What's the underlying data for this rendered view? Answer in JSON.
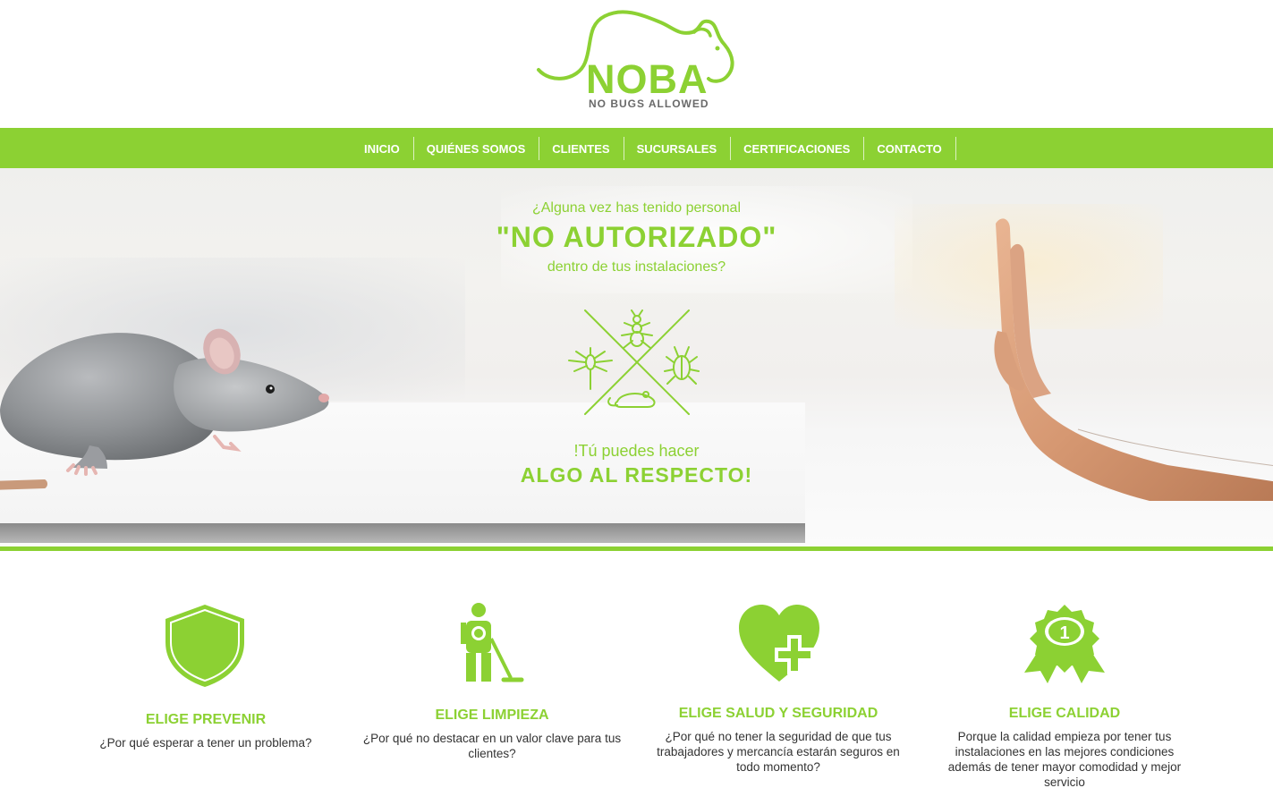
{
  "brand": {
    "name": "NOBA",
    "tagline": "NO BUGS ALLOWED",
    "color": "#8cd133"
  },
  "nav": {
    "items": [
      {
        "label": "INICIO"
      },
      {
        "label": "QUIÉNES SOMOS"
      },
      {
        "label": "CLIENTES"
      },
      {
        "label": "SUCURSALES"
      },
      {
        "label": "CERTIFICACIONES"
      },
      {
        "label": "CONTACTO"
      }
    ]
  },
  "hero": {
    "question_line1": "¿Alguna vez has tenido personal",
    "headline": "\"NO AUTORIZADO\"",
    "question_line2": "dentro de tus instalaciones?",
    "cta_line1": "!Tú puedes hacer",
    "cta_line2": "ALGO AL RESPECTO!",
    "images": [
      "rat-photo",
      "stop-hand-photo",
      "no-pests-emblem"
    ]
  },
  "features": [
    {
      "icon": "shield-icon",
      "title": "ELIGE PREVENIR",
      "text": "¿Por qué esperar a tener un problema?"
    },
    {
      "icon": "cleaner-icon",
      "title": "ELIGE LIMPIEZA",
      "text": "¿Por qué no destacar en un valor clave para tus clientes?"
    },
    {
      "icon": "heart-plus-icon",
      "title": "ELIGE SALUD Y SEGURIDAD",
      "text": "¿Por qué no tener la seguridad de que tus trabajadores y mercancía estarán seguros en todo momento?"
    },
    {
      "icon": "award-ribbon-icon",
      "title": "ELIGE CALIDAD",
      "text": "Porque la calidad empieza por tener tus instalaciones en las mejores condiciones además de tener mayor comodidad y mejor servicio",
      "badge": "1"
    }
  ]
}
